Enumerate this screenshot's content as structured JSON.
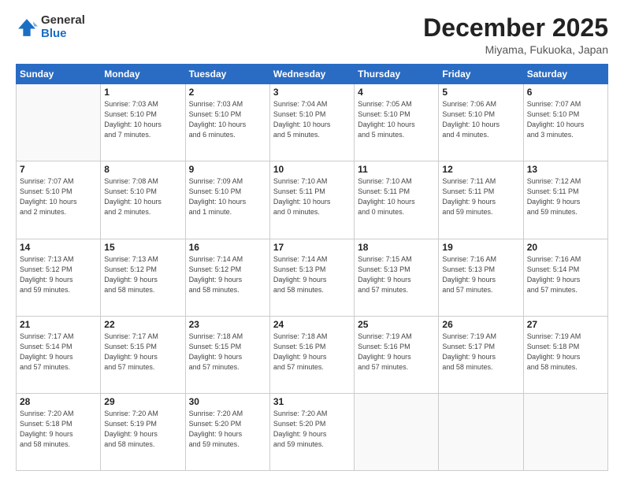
{
  "logo": {
    "general": "General",
    "blue": "Blue"
  },
  "header": {
    "month": "December 2025",
    "location": "Miyama, Fukuoka, Japan"
  },
  "days_of_week": [
    "Sunday",
    "Monday",
    "Tuesday",
    "Wednesday",
    "Thursday",
    "Friday",
    "Saturday"
  ],
  "weeks": [
    [
      {
        "day": "",
        "info": ""
      },
      {
        "day": "1",
        "info": "Sunrise: 7:03 AM\nSunset: 5:10 PM\nDaylight: 10 hours\nand 7 minutes."
      },
      {
        "day": "2",
        "info": "Sunrise: 7:03 AM\nSunset: 5:10 PM\nDaylight: 10 hours\nand 6 minutes."
      },
      {
        "day": "3",
        "info": "Sunrise: 7:04 AM\nSunset: 5:10 PM\nDaylight: 10 hours\nand 5 minutes."
      },
      {
        "day": "4",
        "info": "Sunrise: 7:05 AM\nSunset: 5:10 PM\nDaylight: 10 hours\nand 5 minutes."
      },
      {
        "day": "5",
        "info": "Sunrise: 7:06 AM\nSunset: 5:10 PM\nDaylight: 10 hours\nand 4 minutes."
      },
      {
        "day": "6",
        "info": "Sunrise: 7:07 AM\nSunset: 5:10 PM\nDaylight: 10 hours\nand 3 minutes."
      }
    ],
    [
      {
        "day": "7",
        "info": "Sunrise: 7:07 AM\nSunset: 5:10 PM\nDaylight: 10 hours\nand 2 minutes."
      },
      {
        "day": "8",
        "info": "Sunrise: 7:08 AM\nSunset: 5:10 PM\nDaylight: 10 hours\nand 2 minutes."
      },
      {
        "day": "9",
        "info": "Sunrise: 7:09 AM\nSunset: 5:10 PM\nDaylight: 10 hours\nand 1 minute."
      },
      {
        "day": "10",
        "info": "Sunrise: 7:10 AM\nSunset: 5:11 PM\nDaylight: 10 hours\nand 0 minutes."
      },
      {
        "day": "11",
        "info": "Sunrise: 7:10 AM\nSunset: 5:11 PM\nDaylight: 10 hours\nand 0 minutes."
      },
      {
        "day": "12",
        "info": "Sunrise: 7:11 AM\nSunset: 5:11 PM\nDaylight: 9 hours\nand 59 minutes."
      },
      {
        "day": "13",
        "info": "Sunrise: 7:12 AM\nSunset: 5:11 PM\nDaylight: 9 hours\nand 59 minutes."
      }
    ],
    [
      {
        "day": "14",
        "info": "Sunrise: 7:13 AM\nSunset: 5:12 PM\nDaylight: 9 hours\nand 59 minutes."
      },
      {
        "day": "15",
        "info": "Sunrise: 7:13 AM\nSunset: 5:12 PM\nDaylight: 9 hours\nand 58 minutes."
      },
      {
        "day": "16",
        "info": "Sunrise: 7:14 AM\nSunset: 5:12 PM\nDaylight: 9 hours\nand 58 minutes."
      },
      {
        "day": "17",
        "info": "Sunrise: 7:14 AM\nSunset: 5:13 PM\nDaylight: 9 hours\nand 58 minutes."
      },
      {
        "day": "18",
        "info": "Sunrise: 7:15 AM\nSunset: 5:13 PM\nDaylight: 9 hours\nand 57 minutes."
      },
      {
        "day": "19",
        "info": "Sunrise: 7:16 AM\nSunset: 5:13 PM\nDaylight: 9 hours\nand 57 minutes."
      },
      {
        "day": "20",
        "info": "Sunrise: 7:16 AM\nSunset: 5:14 PM\nDaylight: 9 hours\nand 57 minutes."
      }
    ],
    [
      {
        "day": "21",
        "info": "Sunrise: 7:17 AM\nSunset: 5:14 PM\nDaylight: 9 hours\nand 57 minutes."
      },
      {
        "day": "22",
        "info": "Sunrise: 7:17 AM\nSunset: 5:15 PM\nDaylight: 9 hours\nand 57 minutes."
      },
      {
        "day": "23",
        "info": "Sunrise: 7:18 AM\nSunset: 5:15 PM\nDaylight: 9 hours\nand 57 minutes."
      },
      {
        "day": "24",
        "info": "Sunrise: 7:18 AM\nSunset: 5:16 PM\nDaylight: 9 hours\nand 57 minutes."
      },
      {
        "day": "25",
        "info": "Sunrise: 7:19 AM\nSunset: 5:16 PM\nDaylight: 9 hours\nand 57 minutes."
      },
      {
        "day": "26",
        "info": "Sunrise: 7:19 AM\nSunset: 5:17 PM\nDaylight: 9 hours\nand 58 minutes."
      },
      {
        "day": "27",
        "info": "Sunrise: 7:19 AM\nSunset: 5:18 PM\nDaylight: 9 hours\nand 58 minutes."
      }
    ],
    [
      {
        "day": "28",
        "info": "Sunrise: 7:20 AM\nSunset: 5:18 PM\nDaylight: 9 hours\nand 58 minutes."
      },
      {
        "day": "29",
        "info": "Sunrise: 7:20 AM\nSunset: 5:19 PM\nDaylight: 9 hours\nand 58 minutes."
      },
      {
        "day": "30",
        "info": "Sunrise: 7:20 AM\nSunset: 5:20 PM\nDaylight: 9 hours\nand 59 minutes."
      },
      {
        "day": "31",
        "info": "Sunrise: 7:20 AM\nSunset: 5:20 PM\nDaylight: 9 hours\nand 59 minutes."
      },
      {
        "day": "",
        "info": ""
      },
      {
        "day": "",
        "info": ""
      },
      {
        "day": "",
        "info": ""
      }
    ]
  ]
}
